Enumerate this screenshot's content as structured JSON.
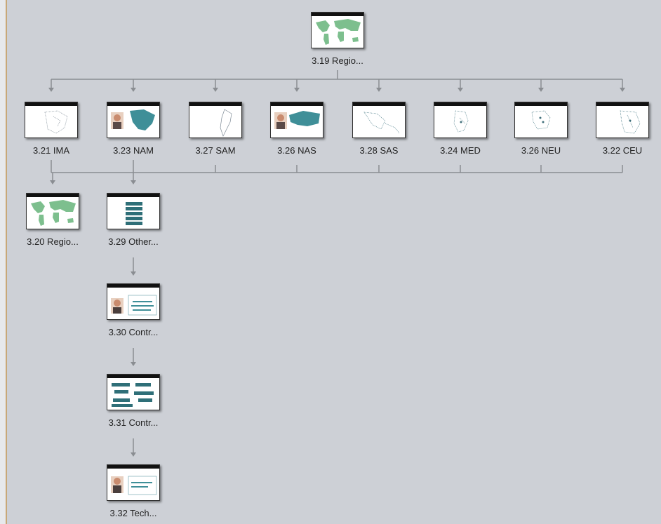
{
  "root": {
    "label": "3.19 Regio...",
    "thumb_icon": "world-map-icon"
  },
  "level1": [
    {
      "id": "ima",
      "label": "3.21 IMA",
      "thumb_icon": "dot-map-icon"
    },
    {
      "id": "nam",
      "label": "3.23 NAM",
      "thumb_icon": "portrait-map-icon"
    },
    {
      "id": "sam",
      "label": "3.27 SAM",
      "thumb_icon": "outline-map-icon"
    },
    {
      "id": "nas",
      "label": "3.26 NAS",
      "thumb_icon": "portrait-map-icon"
    },
    {
      "id": "sas",
      "label": "3.28 SAS",
      "thumb_icon": "dot-map-icon"
    },
    {
      "id": "med",
      "label": "3.24 MED",
      "thumb_icon": "dot-map-icon"
    },
    {
      "id": "neu",
      "label": "3.26 NEU",
      "thumb_icon": "dot-map-icon"
    },
    {
      "id": "ceu",
      "label": "3.22 CEU",
      "thumb_icon": "dot-map-icon"
    }
  ],
  "level2": [
    {
      "id": "regio2",
      "label": "3.20 Regio...",
      "thumb_icon": "world-map-icon"
    },
    {
      "id": "other",
      "label": "3.29 Other...",
      "thumb_icon": "list-icon"
    }
  ],
  "chain": [
    {
      "id": "contr1",
      "label": "3.30 Contr...",
      "thumb_icon": "portrait-text-icon"
    },
    {
      "id": "contr2",
      "label": "3.31 Contr...",
      "thumb_icon": "boxes-icon"
    },
    {
      "id": "tech",
      "label": "3.32 Tech...",
      "thumb_icon": "portrait-text-icon"
    }
  ],
  "colors": {
    "background": "#cdd0d6",
    "connector": "#8a8d92",
    "map_green": "#7dbf8e",
    "map_teal": "#3f8f98"
  }
}
